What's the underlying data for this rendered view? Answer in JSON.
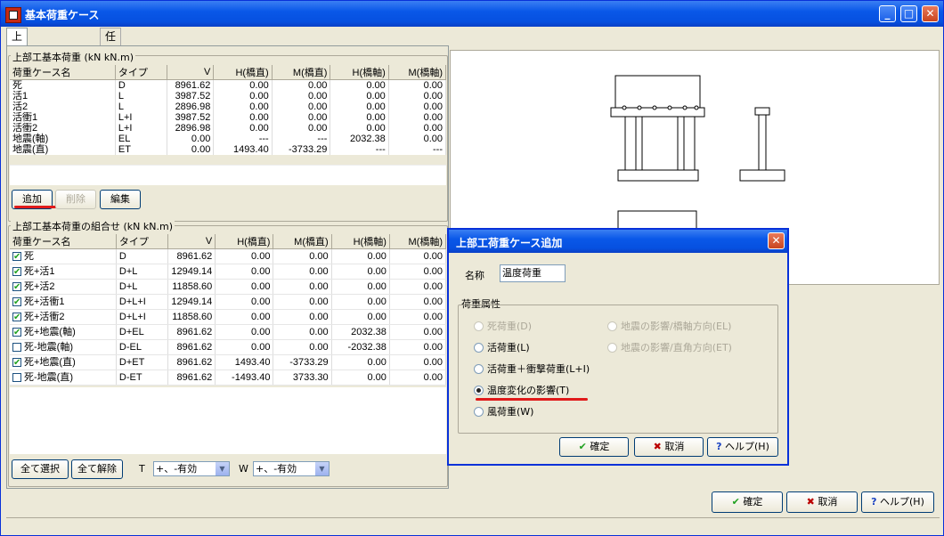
{
  "window": {
    "title": "基本荷重ケース"
  },
  "tabs": [
    {
      "label": "上部工荷重ケース"
    },
    {
      "label": "任意荷重ケース"
    }
  ],
  "basic": {
    "group_title": "上部工基本荷重 (kN kN.m)",
    "headers": [
      "荷重ケース名",
      "タイプ",
      "V",
      "H(橋直)",
      "M(橋直)",
      "H(橋軸)",
      "M(橋軸)"
    ],
    "rows": [
      [
        "死",
        "D",
        "8961.62",
        "0.00",
        "0.00",
        "0.00",
        "0.00"
      ],
      [
        "活1",
        "L",
        "3987.52",
        "0.00",
        "0.00",
        "0.00",
        "0.00"
      ],
      [
        "活2",
        "L",
        "2896.98",
        "0.00",
        "0.00",
        "0.00",
        "0.00"
      ],
      [
        "活衝1",
        "L+I",
        "3987.52",
        "0.00",
        "0.00",
        "0.00",
        "0.00"
      ],
      [
        "活衝2",
        "L+I",
        "2896.98",
        "0.00",
        "0.00",
        "0.00",
        "0.00"
      ],
      [
        "地震(軸)",
        "EL",
        "0.00",
        "---",
        "---",
        "2032.38",
        "0.00"
      ],
      [
        "地震(直)",
        "ET",
        "0.00",
        "1493.40",
        "-3733.29",
        "---",
        "---"
      ]
    ],
    "buttons": {
      "add": "追加",
      "delete": "削除",
      "edit": "編集"
    }
  },
  "combo": {
    "group_title": "上部工基本荷重の組合せ (kN kN.m)",
    "headers": [
      "荷重ケース名",
      "タイプ",
      "V",
      "H(橋直)",
      "M(橋直)",
      "H(橋軸)",
      "M(橋軸)"
    ],
    "rows": [
      {
        "checked": true,
        "cells": [
          "死",
          "D",
          "8961.62",
          "0.00",
          "0.00",
          "0.00",
          "0.00"
        ]
      },
      {
        "checked": true,
        "cells": [
          "死+活1",
          "D+L",
          "12949.14",
          "0.00",
          "0.00",
          "0.00",
          "0.00"
        ]
      },
      {
        "checked": true,
        "cells": [
          "死+活2",
          "D+L",
          "11858.60",
          "0.00",
          "0.00",
          "0.00",
          "0.00"
        ]
      },
      {
        "checked": true,
        "cells": [
          "死+活衝1",
          "D+L+I",
          "12949.14",
          "0.00",
          "0.00",
          "0.00",
          "0.00"
        ]
      },
      {
        "checked": true,
        "cells": [
          "死+活衝2",
          "D+L+I",
          "11858.60",
          "0.00",
          "0.00",
          "0.00",
          "0.00"
        ]
      },
      {
        "checked": true,
        "cells": [
          "死+地震(軸)",
          "D+EL",
          "8961.62",
          "0.00",
          "0.00",
          "2032.38",
          "0.00"
        ]
      },
      {
        "checked": false,
        "cells": [
          "死-地震(軸)",
          "D-EL",
          "8961.62",
          "0.00",
          "0.00",
          "-2032.38",
          "0.00"
        ]
      },
      {
        "checked": true,
        "cells": [
          "死+地震(直)",
          "D+ET",
          "8961.62",
          "1493.40",
          "-3733.29",
          "0.00",
          "0.00"
        ]
      },
      {
        "checked": false,
        "cells": [
          "死-地震(直)",
          "D-ET",
          "8961.62",
          "-1493.40",
          "3733.30",
          "0.00",
          "0.00"
        ]
      }
    ],
    "buttons": {
      "select_all": "全て選択",
      "clear_all": "全て解除"
    },
    "t_label": "T",
    "t_value": "+、-有効",
    "w_label": "W",
    "w_value": "+、-有効"
  },
  "dialog": {
    "title": "上部工荷重ケース追加",
    "name_label": "名称",
    "name_value": "温度荷重",
    "attr_group": "荷重属性",
    "radios": {
      "dead": "死荷重(D)",
      "live": "活荷重(L)",
      "live_impact": "活荷重＋衝撃荷重(L+I)",
      "temp": "温度変化の影響(T)",
      "wind": "風荷重(W)",
      "eq_axis": "地震の影響/橋軸方向(EL)",
      "eq_perp": "地震の影響/直角方向(ET)"
    },
    "ok": "確定",
    "cancel": "取消",
    "help": "ヘルプ(H)"
  },
  "main_buttons": {
    "ok": "確定",
    "cancel": "取消",
    "help": "ヘルプ(H)"
  }
}
